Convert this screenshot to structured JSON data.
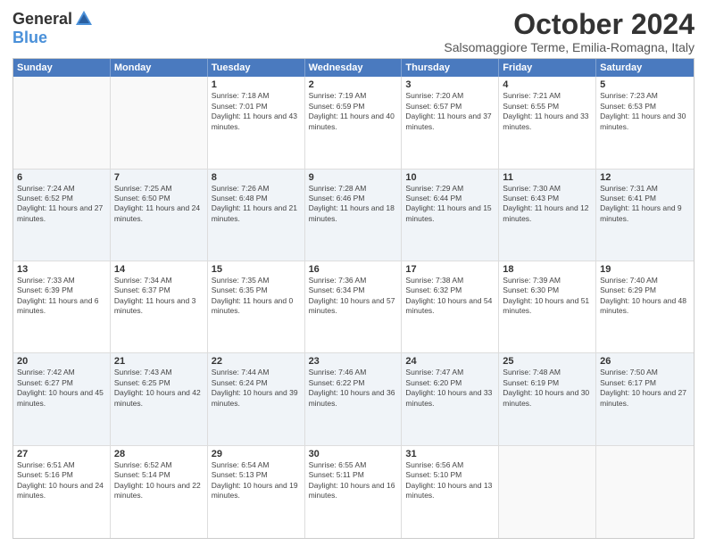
{
  "logo": {
    "general": "General",
    "blue": "Blue"
  },
  "title": "October 2024",
  "location": "Salsomaggiore Terme, Emilia-Romagna, Italy",
  "days": [
    "Sunday",
    "Monday",
    "Tuesday",
    "Wednesday",
    "Thursday",
    "Friday",
    "Saturday"
  ],
  "weeks": [
    [
      {
        "day": "",
        "sunrise": "",
        "sunset": "",
        "daylight": ""
      },
      {
        "day": "",
        "sunrise": "",
        "sunset": "",
        "daylight": ""
      },
      {
        "day": "1",
        "sunrise": "Sunrise: 7:18 AM",
        "sunset": "Sunset: 7:01 PM",
        "daylight": "Daylight: 11 hours and 43 minutes."
      },
      {
        "day": "2",
        "sunrise": "Sunrise: 7:19 AM",
        "sunset": "Sunset: 6:59 PM",
        "daylight": "Daylight: 11 hours and 40 minutes."
      },
      {
        "day": "3",
        "sunrise": "Sunrise: 7:20 AM",
        "sunset": "Sunset: 6:57 PM",
        "daylight": "Daylight: 11 hours and 37 minutes."
      },
      {
        "day": "4",
        "sunrise": "Sunrise: 7:21 AM",
        "sunset": "Sunset: 6:55 PM",
        "daylight": "Daylight: 11 hours and 33 minutes."
      },
      {
        "day": "5",
        "sunrise": "Sunrise: 7:23 AM",
        "sunset": "Sunset: 6:53 PM",
        "daylight": "Daylight: 11 hours and 30 minutes."
      }
    ],
    [
      {
        "day": "6",
        "sunrise": "Sunrise: 7:24 AM",
        "sunset": "Sunset: 6:52 PM",
        "daylight": "Daylight: 11 hours and 27 minutes."
      },
      {
        "day": "7",
        "sunrise": "Sunrise: 7:25 AM",
        "sunset": "Sunset: 6:50 PM",
        "daylight": "Daylight: 11 hours and 24 minutes."
      },
      {
        "day": "8",
        "sunrise": "Sunrise: 7:26 AM",
        "sunset": "Sunset: 6:48 PM",
        "daylight": "Daylight: 11 hours and 21 minutes."
      },
      {
        "day": "9",
        "sunrise": "Sunrise: 7:28 AM",
        "sunset": "Sunset: 6:46 PM",
        "daylight": "Daylight: 11 hours and 18 minutes."
      },
      {
        "day": "10",
        "sunrise": "Sunrise: 7:29 AM",
        "sunset": "Sunset: 6:44 PM",
        "daylight": "Daylight: 11 hours and 15 minutes."
      },
      {
        "day": "11",
        "sunrise": "Sunrise: 7:30 AM",
        "sunset": "Sunset: 6:43 PM",
        "daylight": "Daylight: 11 hours and 12 minutes."
      },
      {
        "day": "12",
        "sunrise": "Sunrise: 7:31 AM",
        "sunset": "Sunset: 6:41 PM",
        "daylight": "Daylight: 11 hours and 9 minutes."
      }
    ],
    [
      {
        "day": "13",
        "sunrise": "Sunrise: 7:33 AM",
        "sunset": "Sunset: 6:39 PM",
        "daylight": "Daylight: 11 hours and 6 minutes."
      },
      {
        "day": "14",
        "sunrise": "Sunrise: 7:34 AM",
        "sunset": "Sunset: 6:37 PM",
        "daylight": "Daylight: 11 hours and 3 minutes."
      },
      {
        "day": "15",
        "sunrise": "Sunrise: 7:35 AM",
        "sunset": "Sunset: 6:35 PM",
        "daylight": "Daylight: 11 hours and 0 minutes."
      },
      {
        "day": "16",
        "sunrise": "Sunrise: 7:36 AM",
        "sunset": "Sunset: 6:34 PM",
        "daylight": "Daylight: 10 hours and 57 minutes."
      },
      {
        "day": "17",
        "sunrise": "Sunrise: 7:38 AM",
        "sunset": "Sunset: 6:32 PM",
        "daylight": "Daylight: 10 hours and 54 minutes."
      },
      {
        "day": "18",
        "sunrise": "Sunrise: 7:39 AM",
        "sunset": "Sunset: 6:30 PM",
        "daylight": "Daylight: 10 hours and 51 minutes."
      },
      {
        "day": "19",
        "sunrise": "Sunrise: 7:40 AM",
        "sunset": "Sunset: 6:29 PM",
        "daylight": "Daylight: 10 hours and 48 minutes."
      }
    ],
    [
      {
        "day": "20",
        "sunrise": "Sunrise: 7:42 AM",
        "sunset": "Sunset: 6:27 PM",
        "daylight": "Daylight: 10 hours and 45 minutes."
      },
      {
        "day": "21",
        "sunrise": "Sunrise: 7:43 AM",
        "sunset": "Sunset: 6:25 PM",
        "daylight": "Daylight: 10 hours and 42 minutes."
      },
      {
        "day": "22",
        "sunrise": "Sunrise: 7:44 AM",
        "sunset": "Sunset: 6:24 PM",
        "daylight": "Daylight: 10 hours and 39 minutes."
      },
      {
        "day": "23",
        "sunrise": "Sunrise: 7:46 AM",
        "sunset": "Sunset: 6:22 PM",
        "daylight": "Daylight: 10 hours and 36 minutes."
      },
      {
        "day": "24",
        "sunrise": "Sunrise: 7:47 AM",
        "sunset": "Sunset: 6:20 PM",
        "daylight": "Daylight: 10 hours and 33 minutes."
      },
      {
        "day": "25",
        "sunrise": "Sunrise: 7:48 AM",
        "sunset": "Sunset: 6:19 PM",
        "daylight": "Daylight: 10 hours and 30 minutes."
      },
      {
        "day": "26",
        "sunrise": "Sunrise: 7:50 AM",
        "sunset": "Sunset: 6:17 PM",
        "daylight": "Daylight: 10 hours and 27 minutes."
      }
    ],
    [
      {
        "day": "27",
        "sunrise": "Sunrise: 6:51 AM",
        "sunset": "Sunset: 5:16 PM",
        "daylight": "Daylight: 10 hours and 24 minutes."
      },
      {
        "day": "28",
        "sunrise": "Sunrise: 6:52 AM",
        "sunset": "Sunset: 5:14 PM",
        "daylight": "Daylight: 10 hours and 22 minutes."
      },
      {
        "day": "29",
        "sunrise": "Sunrise: 6:54 AM",
        "sunset": "Sunset: 5:13 PM",
        "daylight": "Daylight: 10 hours and 19 minutes."
      },
      {
        "day": "30",
        "sunrise": "Sunrise: 6:55 AM",
        "sunset": "Sunset: 5:11 PM",
        "daylight": "Daylight: 10 hours and 16 minutes."
      },
      {
        "day": "31",
        "sunrise": "Sunrise: 6:56 AM",
        "sunset": "Sunset: 5:10 PM",
        "daylight": "Daylight: 10 hours and 13 minutes."
      },
      {
        "day": "",
        "sunrise": "",
        "sunset": "",
        "daylight": ""
      },
      {
        "day": "",
        "sunrise": "",
        "sunset": "",
        "daylight": ""
      }
    ]
  ]
}
